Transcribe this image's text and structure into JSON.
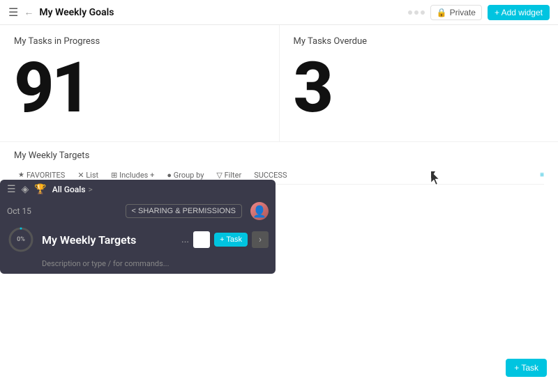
{
  "header": {
    "title": "My Weekly Goals",
    "private_label": "Private",
    "add_widget_label": "+ Add widget"
  },
  "widgets": [
    {
      "id": "tasks-in-progress",
      "title": "My Tasks in Progress",
      "number": "91"
    },
    {
      "id": "tasks-overdue",
      "title": "My Tasks Overdue",
      "number": "3"
    }
  ],
  "targets_section": {
    "title": "My Weekly Targets"
  },
  "filter_bar": {
    "items": [
      {
        "id": "favorites",
        "label": "FAVORITES"
      },
      {
        "id": "list",
        "label": "✕  List"
      },
      {
        "id": "includes",
        "label": "⊞  Includes +"
      },
      {
        "id": "group-by",
        "label": "●  Group by"
      },
      {
        "id": "filter",
        "label": "▽  Filter"
      },
      {
        "id": "success",
        "label": "SUCCESS"
      }
    ],
    "action_icon": "≡"
  },
  "popup": {
    "icons": [
      "≡",
      "◈",
      "🏆"
    ],
    "breadcrumb": [
      "All Goals",
      ">"
    ],
    "date": "Oct 15",
    "share_label": "< SHARING & PERMISSIONS",
    "progress_label": "0%",
    "title": "My Weekly Targets",
    "desc_placeholder": "Description or type / for commands...",
    "button_task": "+ Task",
    "ellipsis": "..."
  },
  "fab": {
    "label": "+ Task"
  }
}
